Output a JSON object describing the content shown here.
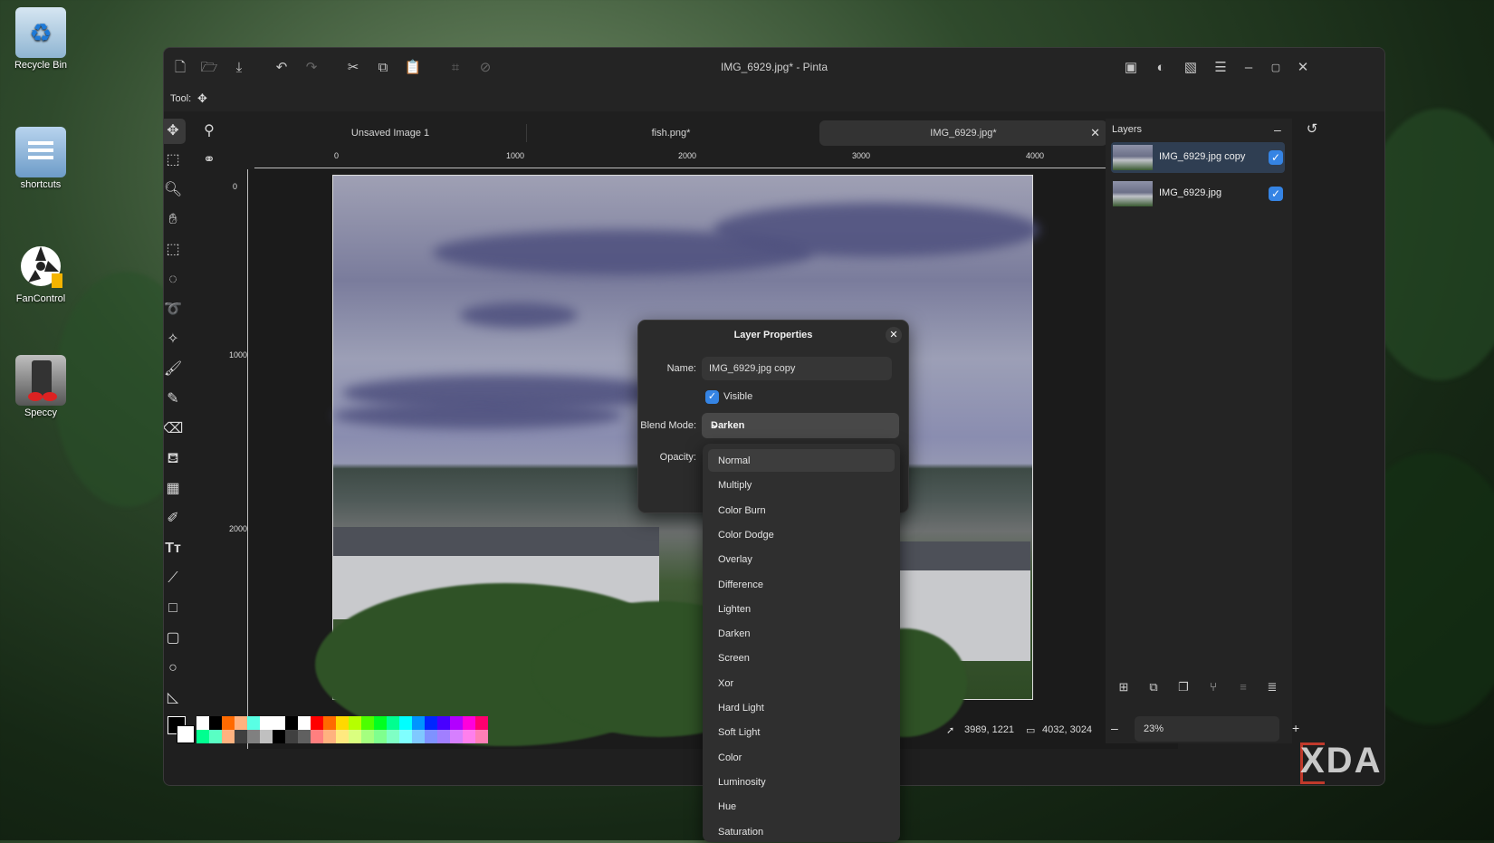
{
  "desktop": {
    "icons": [
      {
        "label": "Recycle Bin"
      },
      {
        "label": "shortcuts"
      },
      {
        "label": "FanControl"
      },
      {
        "label": "Speccy"
      }
    ]
  },
  "window": {
    "title": "IMG_6929.jpg* - Pinta",
    "tool_label": "Tool:"
  },
  "tabs": [
    {
      "label": "Unsaved Image 1"
    },
    {
      "label": "fish.png*"
    },
    {
      "label": "IMG_6929.jpg*"
    }
  ],
  "rulers": {
    "h_labels": [
      "0",
      "1000",
      "2000",
      "3000",
      "4000"
    ],
    "v_labels": [
      "0",
      "1000",
      "2000"
    ]
  },
  "layers": {
    "title": "Layers",
    "items": [
      {
        "name": "IMG_6929.jpg copy",
        "visible": true,
        "selected": true
      },
      {
        "name": "IMG_6929.jpg",
        "visible": true,
        "selected": false
      }
    ]
  },
  "dialog": {
    "title": "Layer Properties",
    "name_label": "Name:",
    "name_value": "IMG_6929.jpg copy",
    "visible_label": "Visible",
    "blend_label": "Blend Mode:",
    "blend_value": "Darken",
    "opacity_label": "Opacity:"
  },
  "blend_modes": [
    "Normal",
    "Multiply",
    "Color Burn",
    "Color Dodge",
    "Overlay",
    "Difference",
    "Lighten",
    "Darken",
    "Screen",
    "Xor",
    "Hard Light",
    "Soft Light",
    "Color",
    "Luminosity",
    "Hue",
    "Saturation"
  ],
  "status": {
    "cursor": "3989, 1221",
    "size": "4032, 3024",
    "zoom": "23%"
  },
  "palette": {
    "row1": [
      "#ffffff",
      "#000000",
      "#ff6a00",
      "#ffb27f",
      "#59ffe4",
      "#ffffff",
      "#ffffff",
      "#000000",
      "#ffffff",
      "#ff0000",
      "#ff6a00",
      "#ffd800",
      "#b6ff00",
      "#4cff00",
      "#00ff21",
      "#00ff90",
      "#00ffff",
      "#0094ff",
      "#0026ff",
      "#4800ff",
      "#b200ff",
      "#ff00dc",
      "#ff006e"
    ],
    "row2": [
      "#00ff90",
      "#59ffc4",
      "#ffb27f",
      "#404040",
      "#808080",
      "#c0c0c0",
      "#000000",
      "#404040",
      "#606060",
      "#ff7f7f",
      "#ffb27f",
      "#ffe97f",
      "#daff7f",
      "#a5ff7f",
      "#7fff8e",
      "#7fffc5",
      "#7fffff",
      "#7fc9ff",
      "#7f92ff",
      "#a17fff",
      "#d67fff",
      "#ff7fed",
      "#ff7fb6"
    ]
  },
  "watermark": "XDA"
}
